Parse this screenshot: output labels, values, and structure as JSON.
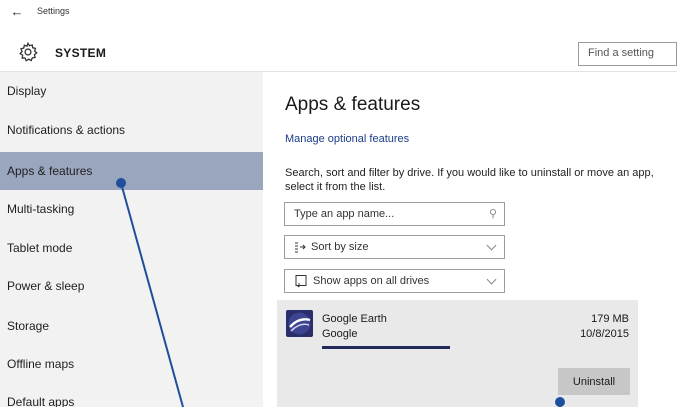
{
  "window": {
    "title": "Settings"
  },
  "header": {
    "section_title": "SYSTEM",
    "search_placeholder": "Find a setting"
  },
  "sidebar": {
    "items": [
      {
        "label": "Display",
        "active": false
      },
      {
        "label": "Notifications & actions",
        "active": false
      },
      {
        "label": "Apps & features",
        "active": true
      },
      {
        "label": "Multi-tasking",
        "active": false
      },
      {
        "label": "Tablet mode",
        "active": false
      },
      {
        "label": "Power & sleep",
        "active": false
      },
      {
        "label": "Storage",
        "active": false
      },
      {
        "label": "Offline maps",
        "active": false
      },
      {
        "label": "Default apps",
        "active": false
      }
    ]
  },
  "main": {
    "title": "Apps & features",
    "manage_link": "Manage optional features",
    "description": "Search, sort and filter by drive. If you would like to uninstall or move an app, select it from the list.",
    "search_placeholder": "Type an app name...",
    "sort_label": "Sort by size",
    "filter_label": "Show apps on all drives",
    "app": {
      "name": "Google Earth",
      "publisher": "Google",
      "size": "179 MB",
      "date": "10/8/2015",
      "size_fraction": 1.0,
      "uninstall_label": "Uninstall"
    }
  },
  "colors": {
    "accent": "#9aa6bd",
    "sidebar_bg": "#f2f2f2",
    "link": "#1b3c87",
    "annotation": "#1f4e9c"
  },
  "icons": {
    "back": "back-arrow-icon",
    "system": "gear-icon",
    "search": "search-icon",
    "sort": "sort-icon",
    "drive": "drive-icon",
    "dropdown": "chevron-down-icon",
    "app": "google-earth-icon"
  }
}
